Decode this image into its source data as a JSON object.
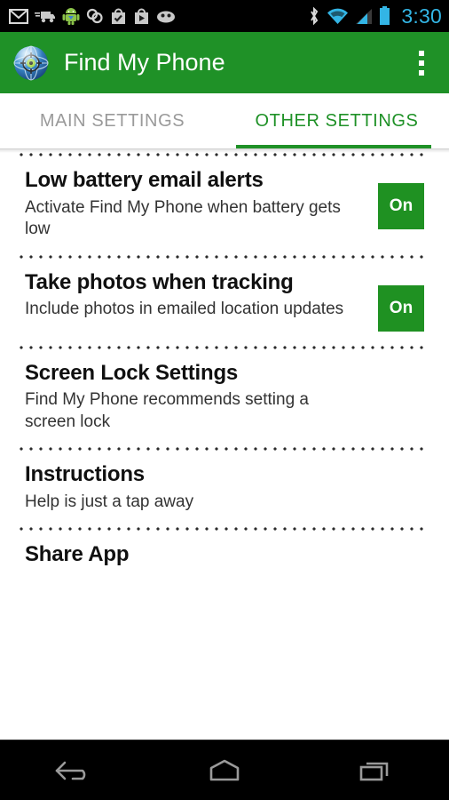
{
  "status_bar": {
    "time": "3:30",
    "time_color": "#33b5e5",
    "left_icons": [
      "gmail-icon",
      "delivery-truck-icon",
      "android-robot-icon",
      "link-icon",
      "checked-bag-icon",
      "play-store-icon",
      "cyanogen-face-icon"
    ],
    "right_icons": [
      "bluetooth-icon",
      "wifi-icon",
      "cellular-signal-icon",
      "battery-icon"
    ]
  },
  "app_bar": {
    "title": "Find My Phone",
    "icon": "globe-target-app-icon",
    "overflow": "overflow-menu-icon",
    "background_color": "#1f9127",
    "title_color": "#ffffff"
  },
  "tabs": {
    "active_index": 1,
    "active_color": "#1f9127",
    "inactive_color": "#9a9a9a",
    "items": [
      {
        "label": "MAIN SETTINGS"
      },
      {
        "label": "OTHER SETTINGS"
      }
    ]
  },
  "settings": {
    "toggle_color": "#1f9122",
    "items": [
      {
        "title": "Low battery email alerts",
        "subtitle": "Activate Find My Phone when battery gets low",
        "toggle": "On"
      },
      {
        "title": "Take photos when tracking",
        "subtitle": "Include photos in emailed location updates",
        "toggle": "On"
      },
      {
        "title": "Screen Lock Settings",
        "subtitle": "Find My Phone recommends setting a screen lock",
        "toggle": null
      },
      {
        "title": "Instructions",
        "subtitle": "Help is just a tap away",
        "toggle": null
      },
      {
        "title": "Share App",
        "subtitle": null,
        "toggle": null
      }
    ]
  },
  "nav_bar": {
    "buttons": [
      "back-button",
      "home-button",
      "recents-button"
    ],
    "icon_color": "#9a9a9a"
  }
}
